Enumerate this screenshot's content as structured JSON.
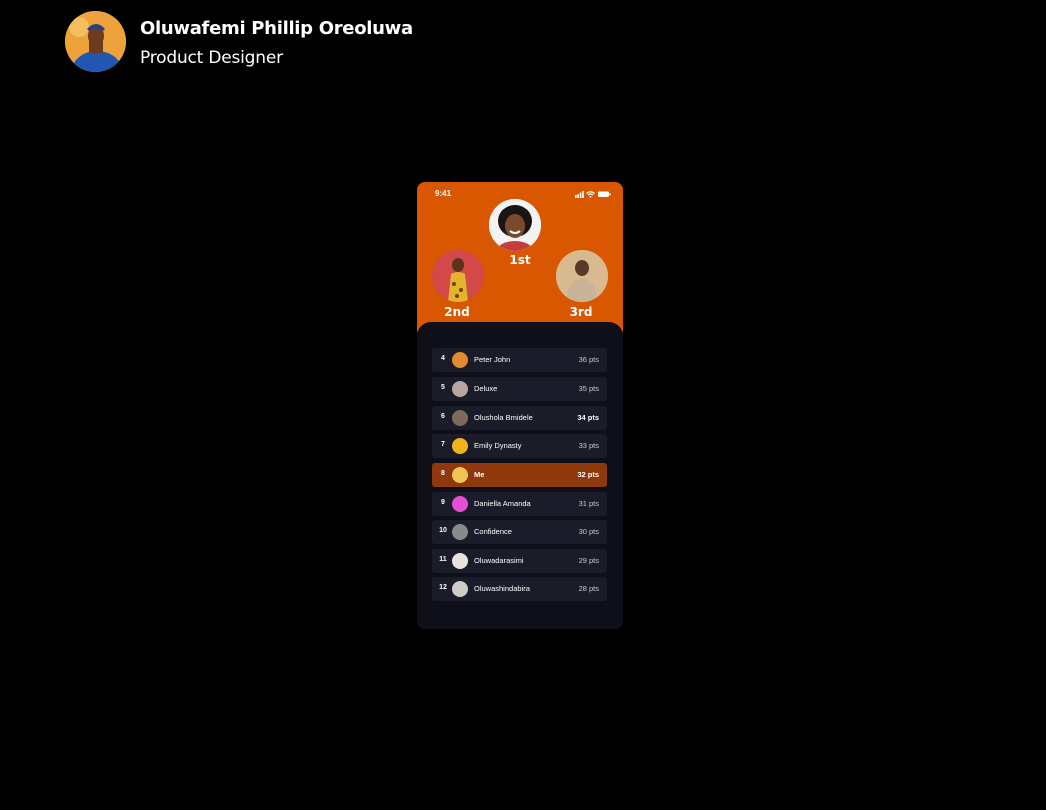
{
  "author": {
    "name": "Oluwafemi Phillip Oreoluwa",
    "role": "Product Designer"
  },
  "phone": {
    "status_time": "9:41",
    "accent_color": "#d95700",
    "podium": [
      {
        "label": "1st"
      },
      {
        "label": "2nd"
      },
      {
        "label": "3rd"
      }
    ],
    "leaderboard": [
      {
        "rank": "4",
        "name": "Peter John",
        "points": "36 pts"
      },
      {
        "rank": "5",
        "name": "Deluxe",
        "points": "35 pts"
      },
      {
        "rank": "6",
        "name": "Olushola Bmidele",
        "points": "34 pts"
      },
      {
        "rank": "7",
        "name": "Emily Dynasty",
        "points": "33 pts"
      },
      {
        "rank": "8",
        "name": "Me",
        "points": "32 pts"
      },
      {
        "rank": "9",
        "name": "Daniella Amanda",
        "points": "31 pts"
      },
      {
        "rank": "10",
        "name": "Confidence",
        "points": "30 pts"
      },
      {
        "rank": "11",
        "name": "Oluwadarasimi",
        "points": "29 pts"
      },
      {
        "rank": "12",
        "name": "Oluwashindabira",
        "points": "28 pts"
      }
    ]
  }
}
